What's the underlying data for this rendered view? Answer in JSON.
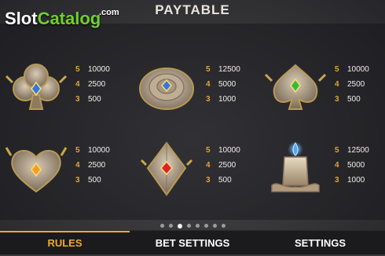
{
  "watermark": {
    "slot": "Slot",
    "catalog": "Catalog",
    "com": ".com"
  },
  "title": "PAYTABLE",
  "symbols": [
    {
      "name": "club-symbol",
      "gem": "#2c7be5",
      "pays": [
        {
          "count": "5",
          "amount": "10000"
        },
        {
          "count": "4",
          "amount": "2500"
        },
        {
          "count": "3",
          "amount": "500"
        }
      ]
    },
    {
      "name": "rose-symbol",
      "gem": "#2c7be5",
      "pays": [
        {
          "count": "5",
          "amount": "12500"
        },
        {
          "count": "4",
          "amount": "5000"
        },
        {
          "count": "3",
          "amount": "1000"
        }
      ]
    },
    {
      "name": "spade-symbol",
      "gem": "#2fbf3a",
      "pays": [
        {
          "count": "5",
          "amount": "10000"
        },
        {
          "count": "4",
          "amount": "2500"
        },
        {
          "count": "3",
          "amount": "500"
        }
      ]
    },
    {
      "name": "heart-symbol",
      "gem": "#f0a020",
      "pays": [
        {
          "count": "5",
          "amount": "10000"
        },
        {
          "count": "4",
          "amount": "2500"
        },
        {
          "count": "3",
          "amount": "500"
        }
      ]
    },
    {
      "name": "diamond-symbol",
      "gem": "#d8232a",
      "pays": [
        {
          "count": "5",
          "amount": "10000"
        },
        {
          "count": "4",
          "amount": "2500"
        },
        {
          "count": "3",
          "amount": "500"
        }
      ]
    },
    {
      "name": "candle-symbol",
      "gem": "#4fa8ff",
      "pays": [
        {
          "count": "5",
          "amount": "12500"
        },
        {
          "count": "4",
          "amount": "5000"
        },
        {
          "count": "3",
          "amount": "1000"
        }
      ]
    }
  ],
  "pagination": {
    "total": 8,
    "current": 3
  },
  "tabs": [
    {
      "label": "RULES",
      "active": true
    },
    {
      "label": "BET SETTINGS",
      "active": false
    },
    {
      "label": "SETTINGS",
      "active": false
    }
  ],
  "colors": {
    "accent": "#f0a92e",
    "pay_count": "#e3a23a",
    "watermark_green": "#6fd12a"
  }
}
